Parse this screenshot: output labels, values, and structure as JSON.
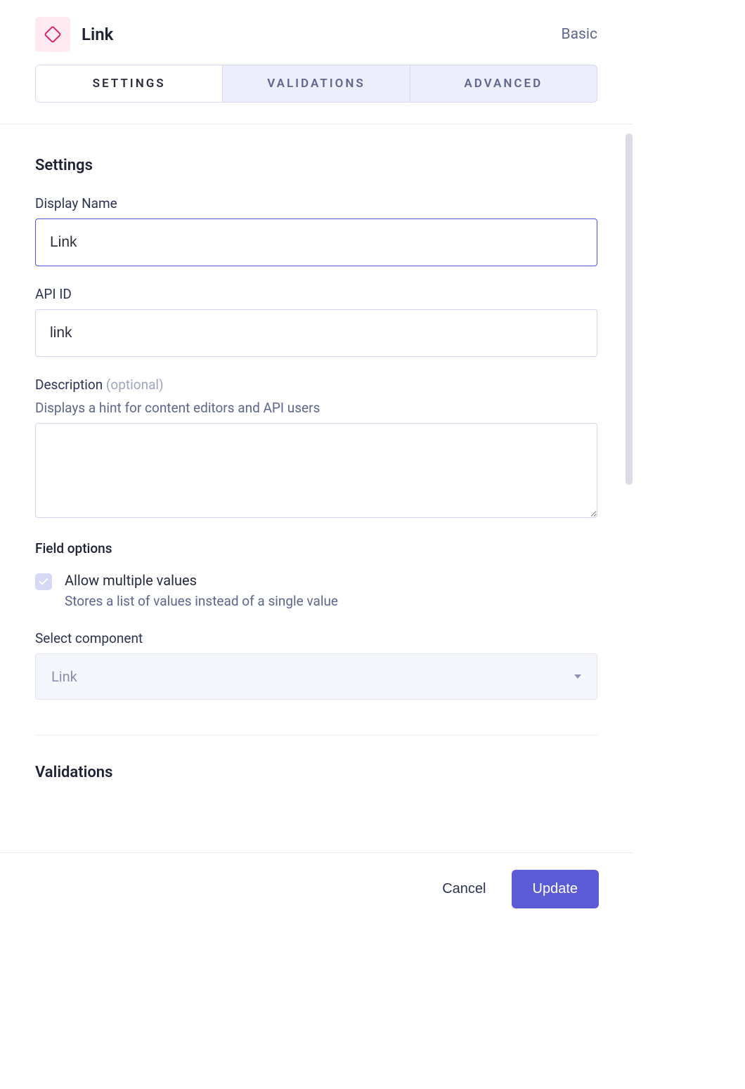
{
  "header": {
    "title": "Link",
    "badge": "Basic",
    "icon": "diamond-icon"
  },
  "tabs": [
    {
      "label": "Settings",
      "active": true
    },
    {
      "label": "Validations",
      "active": false
    },
    {
      "label": "Advanced",
      "active": false
    }
  ],
  "settings": {
    "heading": "Settings",
    "displayName": {
      "label": "Display Name",
      "value": "Link"
    },
    "apiId": {
      "label": "API ID",
      "value": "link"
    },
    "description": {
      "label": "Description",
      "optional": "(optional)",
      "hint": "Displays a hint for content editors and API users",
      "value": ""
    },
    "fieldOptions": {
      "heading": "Field options",
      "allowMultiple": {
        "label": "Allow multiple values",
        "sub": "Stores a list of values instead of a single value",
        "checked": true
      }
    },
    "selectComponent": {
      "label": "Select component",
      "value": "Link"
    }
  },
  "validations": {
    "heading": "Validations"
  },
  "footer": {
    "cancel": "Cancel",
    "submit": "Update"
  }
}
